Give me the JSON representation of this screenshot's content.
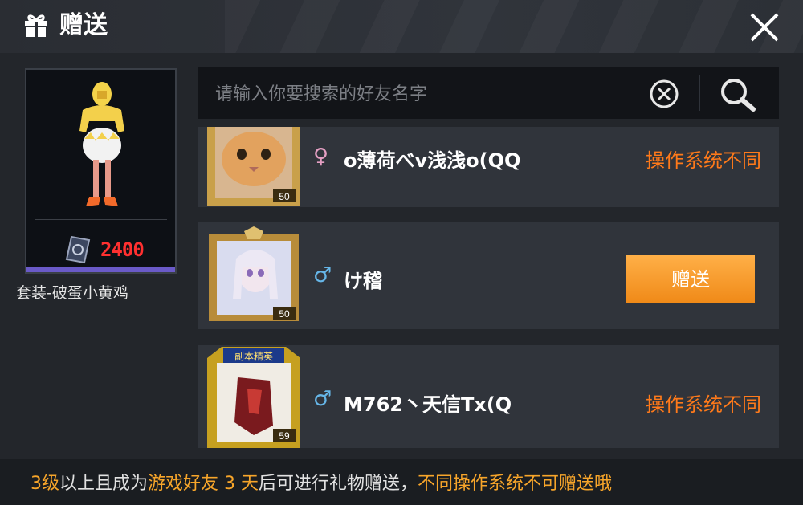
{
  "header": {
    "title": "赠送"
  },
  "item": {
    "price": "2400",
    "name": "套装-破蛋小黄鸡"
  },
  "search": {
    "placeholder": "请输入你要搜索的好友名字",
    "value": ""
  },
  "friends": [
    {
      "gender_symbol": "♀",
      "name": "o薄荷べv浅浅o(QQ",
      "level": "50",
      "status": "操作系统不同"
    },
    {
      "gender_symbol": "♂",
      "name": "け稽",
      "level": "50",
      "action_label": "赠送"
    },
    {
      "gender_symbol": "♂",
      "name": "M762丶天信Tx(Q",
      "level": "59",
      "badge": "副本精英",
      "status": "操作系统不同"
    }
  ],
  "footer": {
    "part1": "3级",
    "part2": "以上且成为",
    "part3": "游戏好友 3 天",
    "part4": "后可进行礼物赠送，",
    "part5": "不同操作系统不可赠送哦"
  },
  "colors": {
    "accent_orange": "#ff7a1a",
    "button_orange": "#f7a030",
    "price_red": "#ff3030",
    "footer_yellow": "#f7a52a"
  }
}
